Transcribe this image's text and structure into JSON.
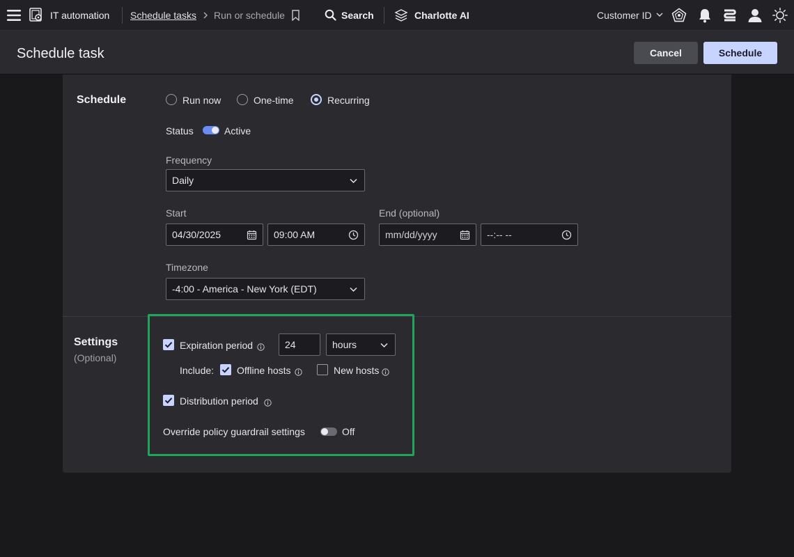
{
  "nav": {
    "app_title": "IT automation",
    "breadcrumb_link": "Schedule tasks",
    "breadcrumb_current": "Run or schedule",
    "search_label": "Search",
    "charlotte_label": "Charlotte AI",
    "customer_label": "Customer ID"
  },
  "header": {
    "title": "Schedule task",
    "cancel_label": "Cancel",
    "schedule_label": "Schedule"
  },
  "schedule": {
    "title": "Schedule",
    "options": [
      "Run now",
      "One-time",
      "Recurring"
    ],
    "selected": "Recurring",
    "status_label": "Status",
    "status_value": "Active",
    "frequency_label": "Frequency",
    "frequency_value": "Daily",
    "start_label": "Start",
    "start_date": "04/30/2025",
    "start_time": "09:00 AM",
    "end_label": "End (optional)",
    "end_date_placeholder": "mm/dd/yyyy",
    "end_time_placeholder": "--:-- --",
    "timezone_label": "Timezone",
    "timezone_value": "-4:00 - America - New York (EDT)"
  },
  "settings": {
    "title": "Settings",
    "subtitle": "(Optional)",
    "expiration_label": "Expiration period",
    "expiration_checked": true,
    "expiration_value": "24",
    "expiration_unit": "hours",
    "include_label": "Include:",
    "offline_hosts_label": "Offline hosts",
    "offline_hosts_checked": true,
    "new_hosts_label": "New hosts",
    "new_hosts_checked": false,
    "distribution_label": "Distribution period",
    "distribution_checked": true,
    "override_label": "Override policy guardrail settings",
    "override_value": "Off"
  },
  "colors": {
    "accent": "#c7d4ff",
    "toggle_on": "#6b8cf0",
    "highlight": "#1fa45a"
  }
}
